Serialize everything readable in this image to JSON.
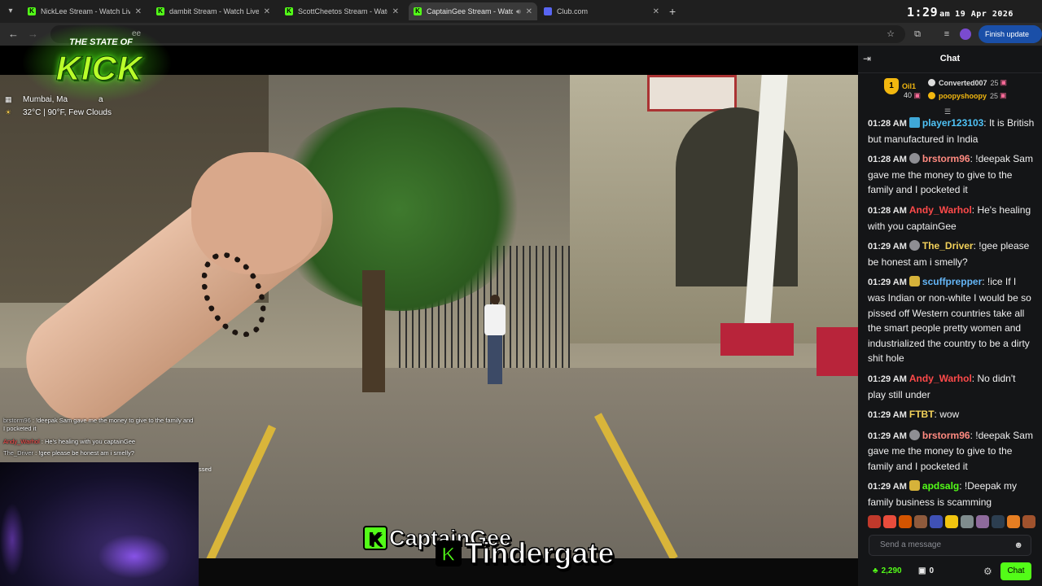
{
  "browser": {
    "tabs": [
      {
        "title": "NickLee Stream - Watch Live on",
        "favicon": "kick-icon"
      },
      {
        "title": "dambit Stream - Watch Live on",
        "favicon": "kick-icon"
      },
      {
        "title": "ScottCheetos Stream - Watch L",
        "favicon": "kick-icon"
      },
      {
        "title": "CaptainGee Stream - Watch",
        "favicon": "kick-icon",
        "active": true,
        "audio": true
      },
      {
        "title": "Club.com",
        "favicon": "club-icon"
      }
    ],
    "omnibox_fragment": "ee",
    "finish_update_label": "Finish update",
    "clock": {
      "time": "1:29",
      "ampm": "am",
      "date": "19 Apr 2026"
    }
  },
  "overlay": {
    "logo_small": "THE STATE OF",
    "logo_big": "KICK",
    "location": "Mumbai, Ma",
    "location_suffix": "a",
    "weather": "32°C | 90°F, Few Clouds",
    "chat": [
      {
        "user": "brstorm96",
        "text": " : !deepak Sam gave me the money to give to the family and"
      },
      {
        "user": "",
        "text": "I pocketed it"
      },
      {
        "user": "Andy_Warhol",
        "text": " : He's healing with you captainGee",
        "red": true
      },
      {
        "user": "The_Driver",
        "text": " : !gee please be honest am i smelly?"
      }
    ],
    "snippet": "ssed",
    "streamer_name": "CaptainGee",
    "stream_title": "Tindergate"
  },
  "chat": {
    "header_title": "Chat",
    "pinned": {
      "top_gifter": "Oil1",
      "top_gifter_count": "40",
      "rank": "1",
      "others": [
        {
          "name": "Converted007",
          "count": "25"
        },
        {
          "name": "poopyshoopy",
          "count": "25"
        }
      ]
    },
    "messages": [
      {
        "time": "01:28 AM",
        "user": "player123103",
        "color": "#4fc3f7",
        "badge": "vip",
        "text": "It is British but manufactured in India"
      },
      {
        "time": "01:28 AM",
        "user": "brstorm96",
        "color": "#ff8a80",
        "badge": "og",
        "text": "!deepak Sam gave me the money to give to the family and I pocketed it"
      },
      {
        "time": "01:28 AM",
        "user": "Andy_Warhol",
        "color": "#ff4a4a",
        "badge": "",
        "text": "He's healing with you captainGee"
      },
      {
        "time": "01:29 AM",
        "user": "The_Driver",
        "color": "#f2d15a",
        "badge": "og",
        "text": "!gee please be honest am i smelly?"
      },
      {
        "time": "01:29 AM",
        "user": "scuffprepper",
        "color": "#64b5f6",
        "badge": "sub",
        "text": "!ice If I was Indian or non-white I would be so pissed off Western countries take all the smart people pretty women and industrialized the country to be a dirty shit hole"
      },
      {
        "time": "01:29 AM",
        "user": "Andy_Warhol",
        "color": "#ff4a4a",
        "badge": "",
        "text": "No didn't play still under"
      },
      {
        "time": "01:29 AM",
        "user": "FTBT",
        "color": "#f2d15a",
        "badge": "",
        "text": "wow"
      },
      {
        "time": "01:29 AM",
        "user": "brstorm96",
        "color": "#ff8a80",
        "badge": "og",
        "text": "!deepak Sam gave me the money to give to the family and I pocketed it"
      },
      {
        "time": "01:29 AM",
        "user": "apdsalg",
        "color": "#53fc18",
        "badge": "sub",
        "text": "!Deepak my family business is scamming"
      }
    ],
    "emotes": [
      "#c0392b",
      "#e74c3c",
      "#d35400",
      "#8e5a3c",
      "#3f51b5",
      "#f1c40f",
      "#7f8c8d",
      "#8e6a9c",
      "#2c3e50",
      "#e67e22",
      "#a0522d"
    ],
    "input_placeholder": "Send a message",
    "points": "2,290",
    "tickets": "0",
    "send_label": "Chat"
  },
  "colors": {
    "kick_green": "#53fc18",
    "chat_bg": "#141517",
    "gold": "#f2b70f"
  }
}
